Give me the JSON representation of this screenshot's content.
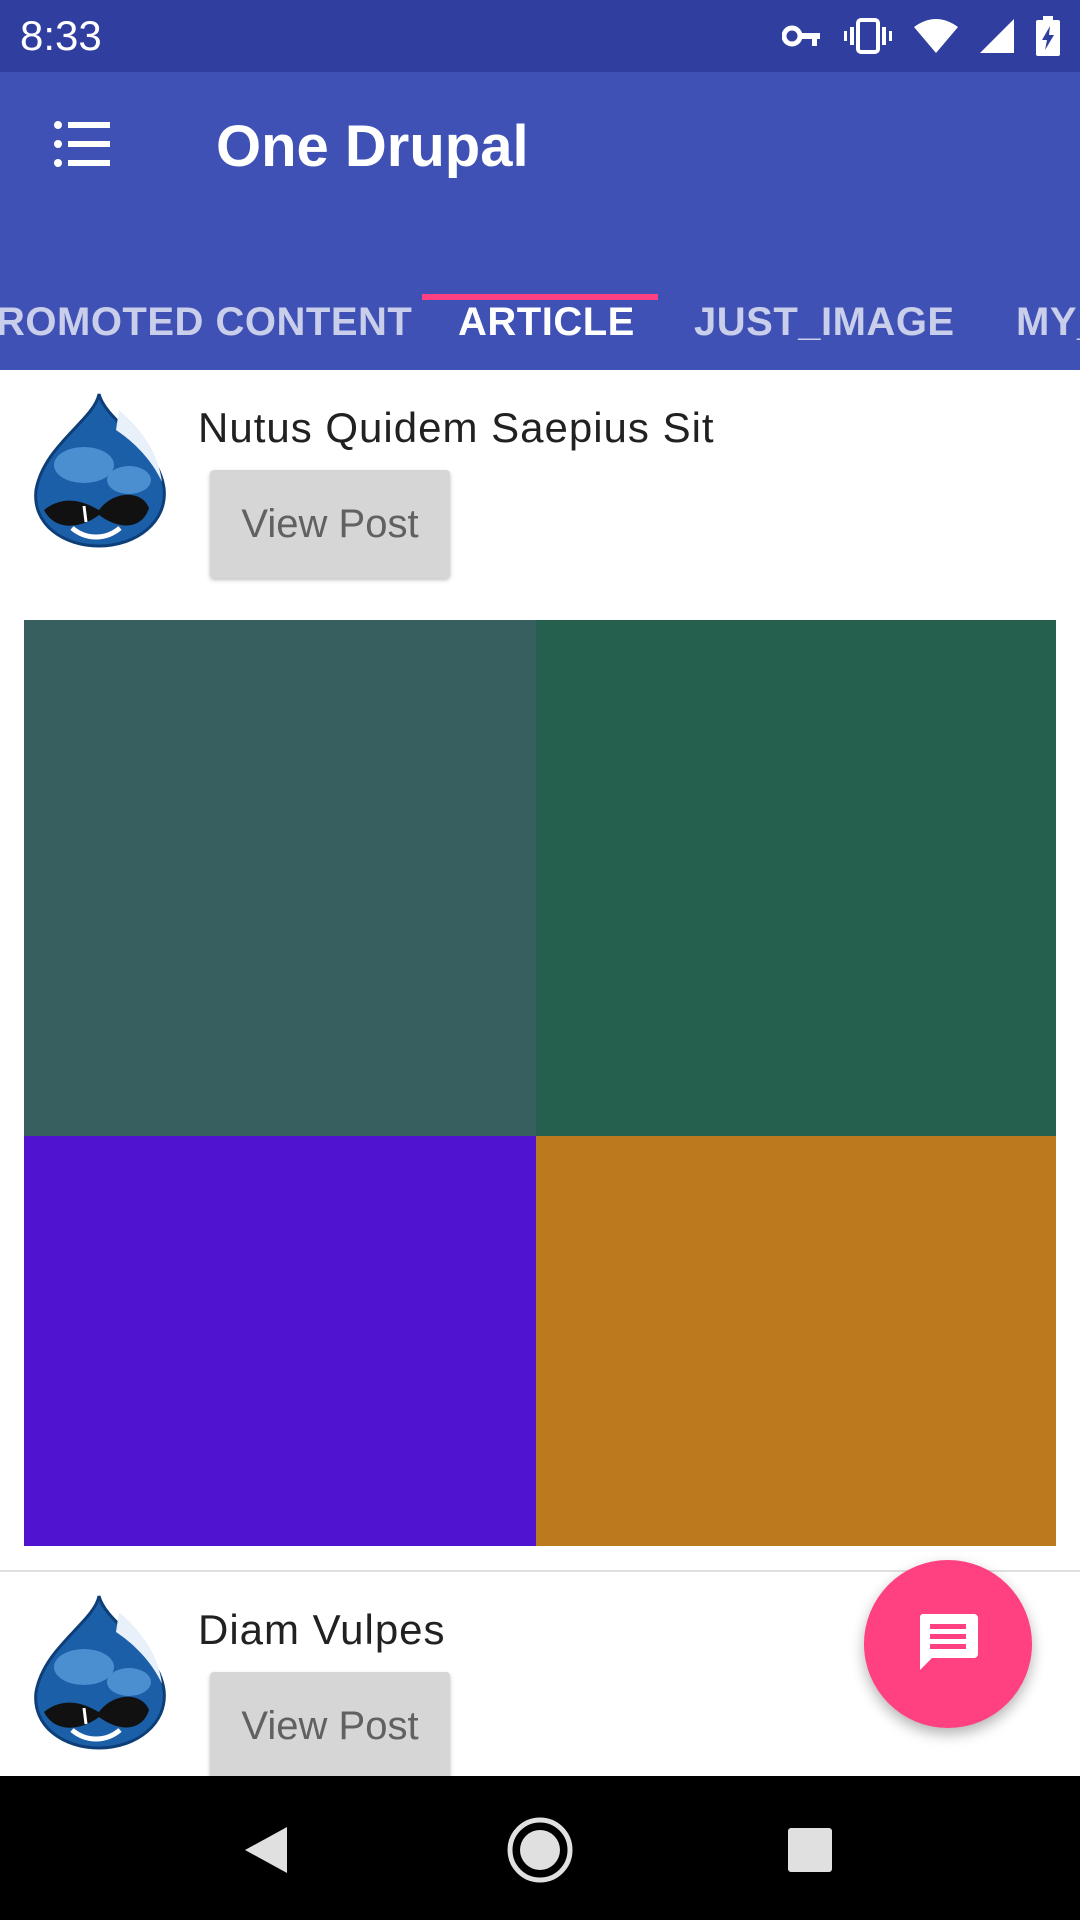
{
  "status_bar": {
    "time": "8:33",
    "icons": [
      "vpn-key-icon",
      "vibrate-icon",
      "wifi-icon",
      "signal-icon",
      "battery-charging-icon"
    ]
  },
  "app_bar": {
    "title": "One Drupal",
    "menu_icon": "menu-icon",
    "tabs": [
      {
        "label": "ROMOTED CONTENT",
        "active": false
      },
      {
        "label": "ARTICLE",
        "active": true
      },
      {
        "label": "JUST_IMAGE",
        "active": false
      },
      {
        "label": "MY_",
        "active": false
      }
    ],
    "indicator_color": "#ff4081",
    "color": "#3f51b5"
  },
  "posts": [
    {
      "title": "Nutus Quidem Saepius Sit",
      "button_label": "View Post",
      "avatar_icon": "drupal-logo-icon",
      "image_colors": [
        "#385f60",
        "#25604e",
        "#5014d0",
        "#bc7a1e"
      ]
    },
    {
      "title": "Diam Vulpes",
      "button_label": "View Post",
      "avatar_icon": "drupal-logo-icon"
    }
  ],
  "fab": {
    "icon": "message-icon",
    "color": "#ff4081"
  },
  "nav_bar": {
    "buttons": [
      "back-icon",
      "home-icon",
      "recents-icon"
    ]
  }
}
